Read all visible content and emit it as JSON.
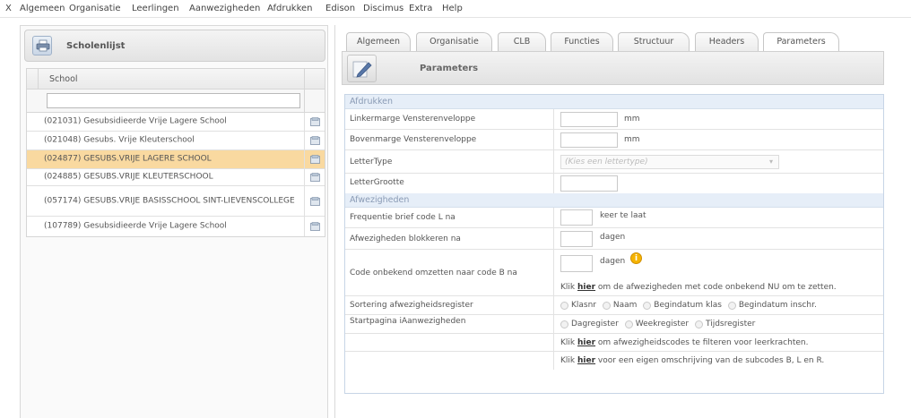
{
  "menu": {
    "close": "X",
    "items": [
      "Algemeen",
      "Organisatie",
      "Leerlingen",
      "Aanwezigheden",
      "Afdrukken",
      "Edison",
      "Discimus",
      "Extra",
      "Help"
    ]
  },
  "left_panel": {
    "title": "Scholenlijst",
    "column_header": "School",
    "filter_value": "",
    "schools": [
      {
        "name": "(021031) Gesubsidieerde Vrije Lagere School",
        "selected": false
      },
      {
        "name": "(021048) Gesubs. Vrije Kleuterschool",
        "selected": false
      },
      {
        "name": "(024877) GESUBS.VRIJE LAGERE SCHOOL",
        "selected": true
      },
      {
        "name": "(024885) GESUBS.VRIJE KLEUTERSCHOOL",
        "selected": false
      },
      {
        "name": "(057174) GESUBS.VRIJE BASISSCHOOL SINT-LIEVENSCOLLEGE",
        "selected": false
      },
      {
        "name": "(107789) Gesubsidieerde Vrije Lagere School",
        "selected": false
      }
    ]
  },
  "tabs": [
    "Algemeen",
    "Organisatie",
    "CLB",
    "Functies",
    "Structuur",
    "Headers",
    "Parameters"
  ],
  "active_tab": "Parameters",
  "panel_title": "Parameters",
  "form": {
    "sections": {
      "print": "Afdrukken",
      "absences": "Afwezigheden"
    },
    "left_margin_label": "Linkermarge Vensterenveloppe",
    "left_margin_value": "",
    "left_margin_unit": "mm",
    "top_margin_label": "Bovenmarge Vensterenveloppe",
    "top_margin_value": "",
    "top_margin_unit": "mm",
    "font_type_label": "LetterType",
    "font_type_placeholder": "(Kies een lettertype)",
    "font_size_label": "LetterGrootte",
    "font_size_value": "",
    "freq_label": "Frequentie brief code L na",
    "freq_unit": "keer te laat",
    "block_label": "Afwezigheden blokkeren na",
    "block_unit": "dagen",
    "code_label": "Code onbekend omzetten naar code B na",
    "code_unit": "dagen",
    "code_link_prefix": "Klik",
    "code_link": "hier",
    "code_link_suffix": "om de afwezigheden met code onbekend NU om te zetten.",
    "sort_label": "Sortering afwezigheidsregister",
    "sort_options": [
      "Klasnr",
      "Naam",
      "Begindatum klas",
      "Begindatum inschr."
    ],
    "start_label": "Startpagina iAanwezigheden",
    "start_options": [
      "Dagregister",
      "Weekregister",
      "Tijdsregister"
    ],
    "filter_link_prefix": "Klik",
    "filter_link": "hier",
    "filter_link_suffix": "om afwezigheidscodes te filteren voor leerkrachten.",
    "desc_link_prefix": "Klik",
    "desc_link": "hier",
    "desc_link_suffix": "voor een eigen omschrijving van de subcodes B, L en R."
  },
  "colors": {
    "selected_row": "#f9d9a0",
    "section_bg": "#e6eef8",
    "info_icon": "#f6b400"
  }
}
